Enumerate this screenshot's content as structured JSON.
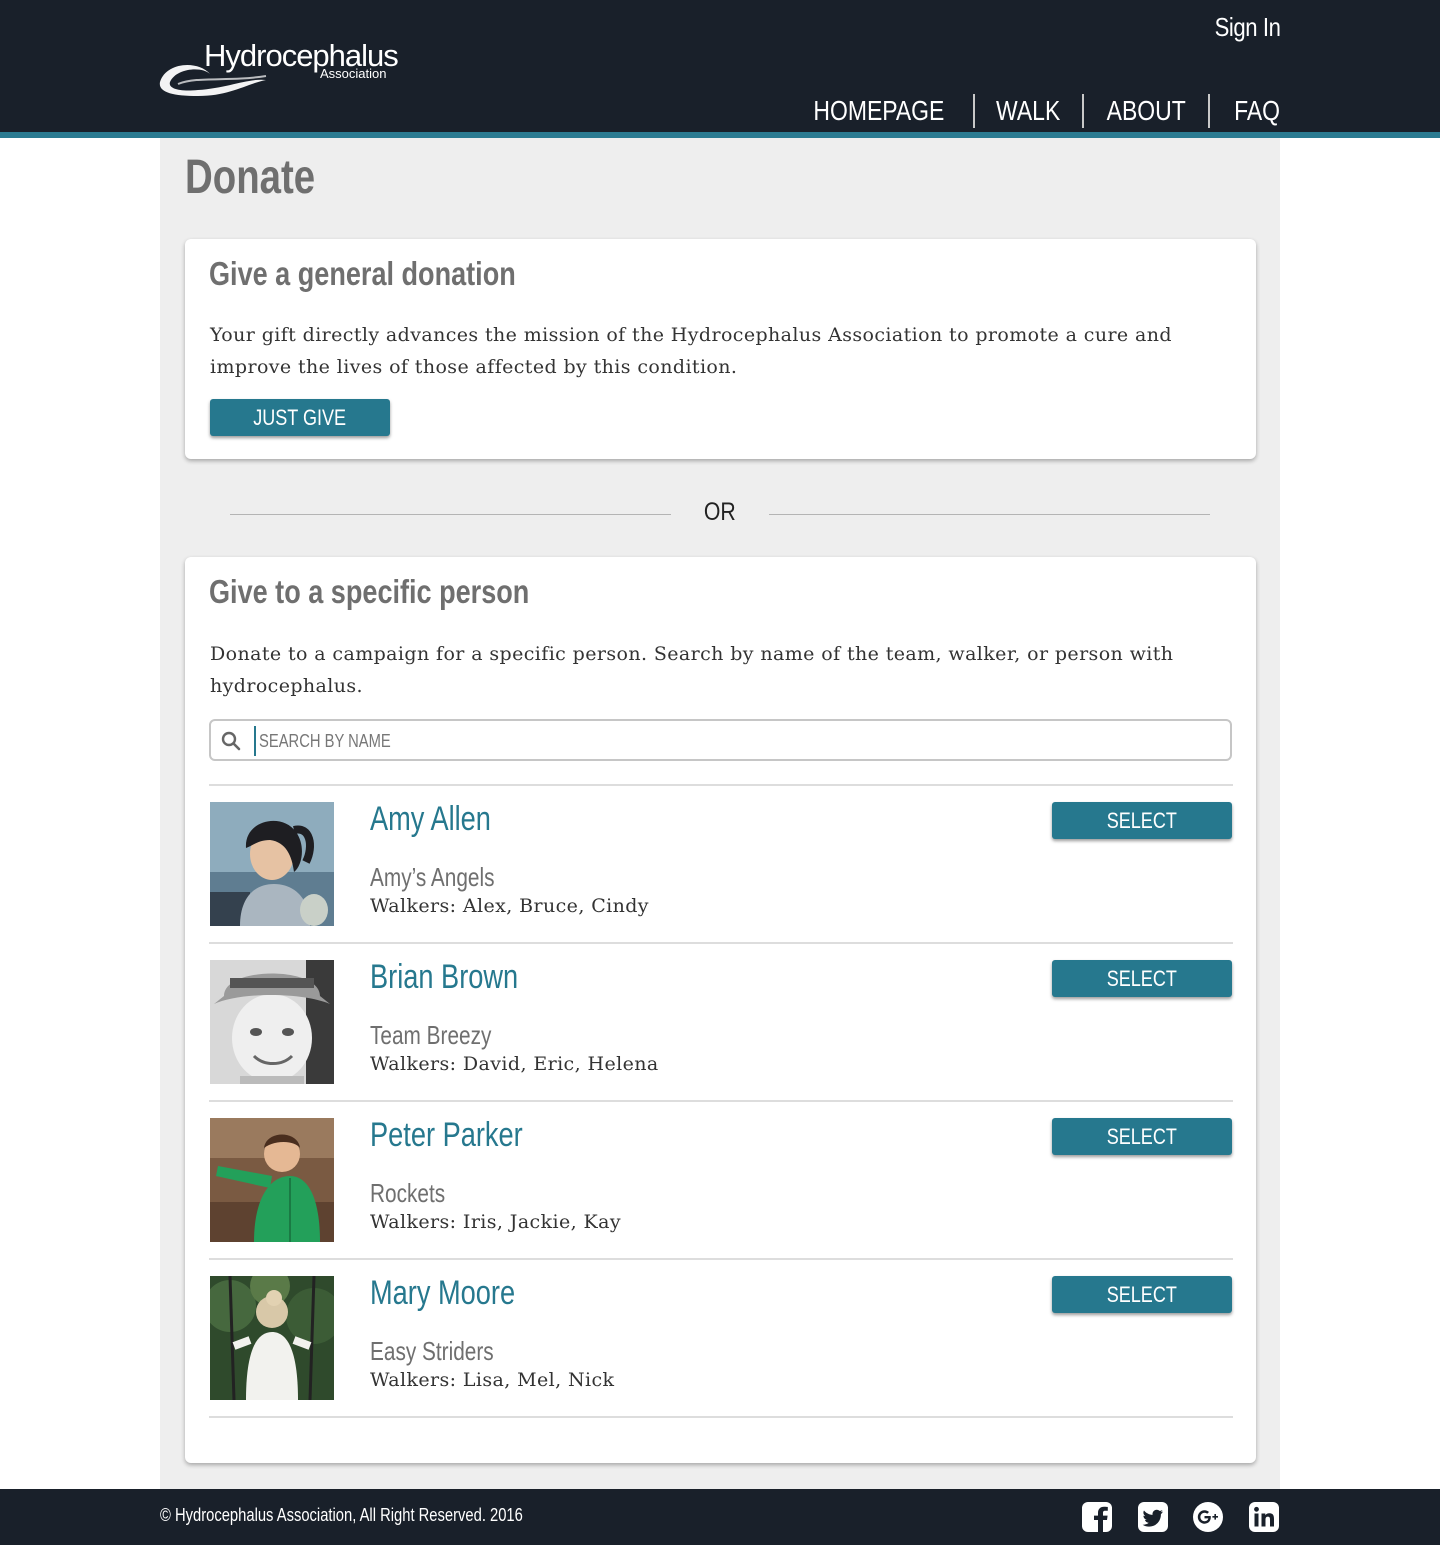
{
  "header": {
    "logo": {
      "main": "Hydrocephalus",
      "sub": "Association"
    },
    "sign_in": "Sign In",
    "nav": [
      "HOMEPAGE",
      "WALK",
      "ABOUT",
      "FAQ"
    ]
  },
  "page": {
    "title": "Donate"
  },
  "general": {
    "title": "Give a general donation",
    "text": "Your gift directly advances the mission of the Hydrocephalus Association to promote a cure and improve the lives of those affected by this condition.",
    "button": "JUST GIVE"
  },
  "or_label": "OR",
  "specific": {
    "title": "Give to a specific person",
    "text": "Donate to a campaign for a specific person. Search by name of the team, walker, or person with hydrocephalus.",
    "search_placeholder": "SEARCH BY NAME",
    "people": [
      {
        "name": "Amy Allen",
        "team": "Amy’s Angels",
        "walkers": "Walkers: Alex, Bruce, Cindy",
        "button": "SELECT",
        "photo": "girl-ponytail-photo"
      },
      {
        "name": "Brian Brown",
        "team": "Team Breezy",
        "walkers": "Walkers: David, Eric, Helena",
        "button": "SELECT",
        "photo": "boy-hat-bw-photo"
      },
      {
        "name": "Peter Parker",
        "team": "Rockets",
        "walkers": "Walkers: Iris, Jackie, Kay",
        "button": "SELECT",
        "photo": "boy-green-jacket-photo"
      },
      {
        "name": "Mary Moore",
        "team": "Easy Striders",
        "walkers": "Walkers: Lisa, Mel, Nick",
        "button": "SELECT",
        "photo": "girl-swing-photo"
      }
    ]
  },
  "footer": {
    "copyright": "©  Hydrocephalus Association, All Right Reserved. 2016",
    "social": [
      "facebook-icon",
      "twitter-icon",
      "google-plus-icon",
      "linkedin-icon"
    ]
  },
  "colors": {
    "header_bg": "#19202a",
    "accent": "#26788e",
    "panel_bg": "#eeeeee",
    "title_gray": "#6f6f6f"
  }
}
